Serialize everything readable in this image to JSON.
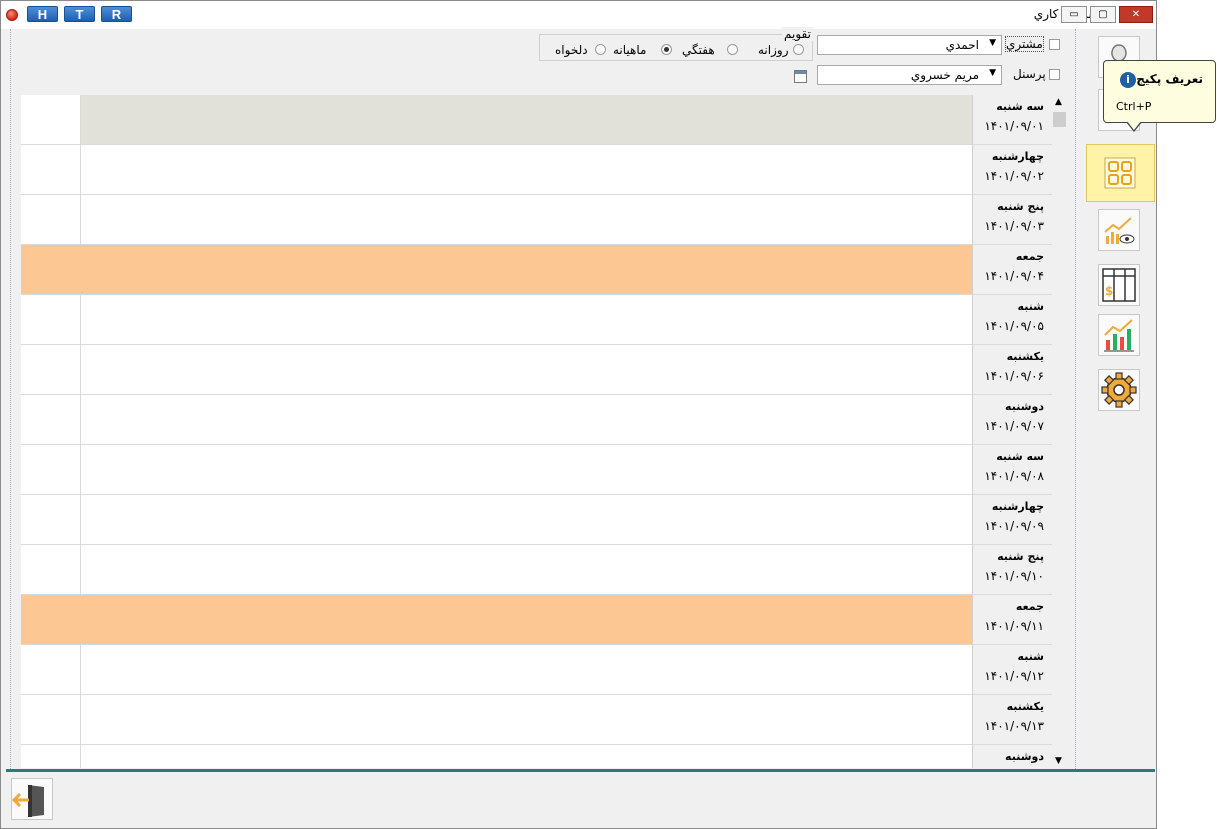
{
  "window": {
    "title": "برنامه كاري",
    "toolbar_buttons": [
      "H",
      "T",
      "R"
    ],
    "controls": {
      "minimize": "▭",
      "maximize": "▢",
      "close": "✕"
    }
  },
  "filters": {
    "customer": {
      "label": "مشتري",
      "value": "احمدي",
      "checked": false
    },
    "personnel": {
      "label": "پرسنل",
      "value": "مريم خسروي",
      "checked": false
    },
    "calendar": {
      "group_label": "تقويم",
      "options": [
        {
          "label": "روزانه",
          "selected": false
        },
        {
          "label": "هفتگي",
          "selected": true
        },
        {
          "label": "ماهيانه",
          "selected": false
        },
        {
          "label": "دلخواه",
          "selected": false
        }
      ]
    }
  },
  "schedule": {
    "rows": [
      {
        "day": "سه شنبه",
        "date": "۱۴۰۱/۰۹/۰۱",
        "state": "selected"
      },
      {
        "day": "چهارشنبه",
        "date": "۱۴۰۱/۰۹/۰۲",
        "state": "normal"
      },
      {
        "day": "پنج شنبه",
        "date": "۱۴۰۱/۰۹/۰۳",
        "state": "normal"
      },
      {
        "day": "جمعه",
        "date": "۱۴۰۱/۰۹/۰۴",
        "state": "holiday"
      },
      {
        "day": "شنبه",
        "date": "۱۴۰۱/۰۹/۰۵",
        "state": "normal"
      },
      {
        "day": "يكشنبه",
        "date": "۱۴۰۱/۰۹/۰۶",
        "state": "normal"
      },
      {
        "day": "دوشنبه",
        "date": "۱۴۰۱/۰۹/۰۷",
        "state": "normal"
      },
      {
        "day": "سه شنبه",
        "date": "۱۴۰۱/۰۹/۰۸",
        "state": "normal"
      },
      {
        "day": "چهارشنبه",
        "date": "۱۴۰۱/۰۹/۰۹",
        "state": "normal"
      },
      {
        "day": "پنج شنبه",
        "date": "۱۴۰۱/۰۹/۱۰",
        "state": "normal"
      },
      {
        "day": "جمعه",
        "date": "۱۴۰۱/۰۹/۱۱",
        "state": "holiday"
      },
      {
        "day": "شنبه",
        "date": "۱۴۰۱/۰۹/۱۲",
        "state": "normal"
      },
      {
        "day": "يكشنبه",
        "date": "۱۴۰۱/۰۹/۱۳",
        "state": "normal"
      },
      {
        "day": "دوشنبه",
        "date": "",
        "state": "normal"
      }
    ],
    "colors": {
      "holiday": "#fdc794",
      "selected": "#e1e1d9"
    }
  },
  "sidebar": {
    "buttons": [
      "user-icon",
      "document-icon",
      "package-grid-icon",
      "chart-view-icon",
      "price-table-icon",
      "growth-chart-icon",
      "gear-icon"
    ],
    "tooltip": {
      "title": "تعريف پكيج",
      "shortcut": "Ctrl+P"
    }
  },
  "footer": {
    "exit_icon": "exit-door-icon"
  },
  "colors": {
    "accent": "#1d5fb1",
    "footer_line": "#2a7a76",
    "active_tool": "#fff3a8"
  }
}
